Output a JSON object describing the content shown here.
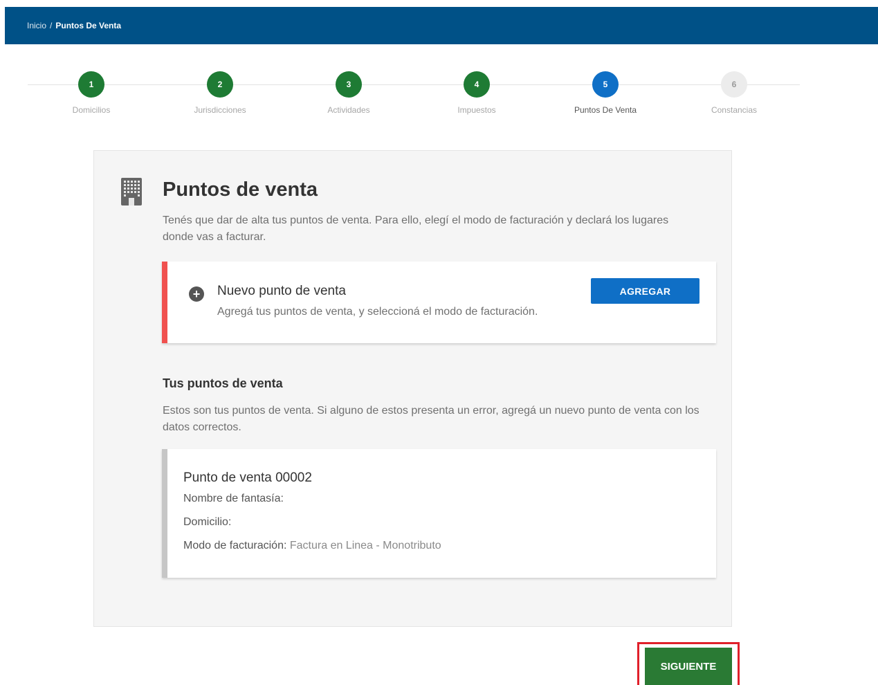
{
  "breadcrumb": {
    "home": "Inicio",
    "separator": "/",
    "current": "Puntos De Venta"
  },
  "steps": [
    {
      "number": "1",
      "label": "Domicilios",
      "state": "done"
    },
    {
      "number": "2",
      "label": "Jurisdicciones",
      "state": "done"
    },
    {
      "number": "3",
      "label": "Actividades",
      "state": "done"
    },
    {
      "number": "4",
      "label": "Impuestos",
      "state": "done"
    },
    {
      "number": "5",
      "label": "Puntos De Venta",
      "state": "active"
    },
    {
      "number": "6",
      "label": "Constancias",
      "state": "pending"
    }
  ],
  "main": {
    "title": "Puntos de venta",
    "intro": "Tenés que dar de alta tus puntos de venta. Para ello, elegí el modo de facturación y declará los lugares donde vas a facturar.",
    "new_point": {
      "title": "Nuevo punto de venta",
      "description": "Agregá tus puntos de venta, y seleccioná el modo de facturación.",
      "button": "AGREGAR"
    },
    "list_title": "Tus puntos de venta",
    "list_description": "Estos son tus puntos de venta. Si alguno de estos presenta un error, agregá un nuevo punto de venta con los datos correctos.",
    "point": {
      "title": "Punto de venta 00002",
      "fantasy_label": "Nombre de fantasía:",
      "fantasy_value": "",
      "address_label": "Domicilio:",
      "address_value": "",
      "billing_label": "Modo de facturación:",
      "billing_value": "Factura en Linea - Monotributo"
    }
  },
  "next_button": "SIGUIENTE",
  "colors": {
    "header": "#005187",
    "step_done": "#1e7b34",
    "step_active": "#0f6fc6",
    "accent_red": "#f0504e",
    "next_button": "#2a7a34",
    "highlight": "#e0202a"
  }
}
